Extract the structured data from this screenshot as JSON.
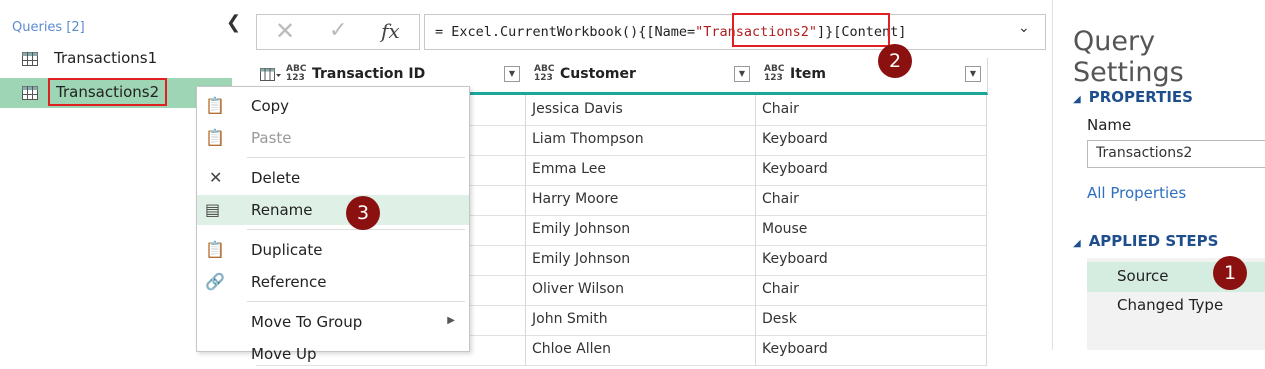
{
  "queries": {
    "header": "Queries [2]",
    "items": [
      {
        "label": "Transactions1"
      },
      {
        "label": "Transactions2"
      }
    ]
  },
  "formula_bar": {
    "prefix": "= Excel.CurrentWorkbook(){[Name=",
    "name_string": "\"Transactions2\"",
    "suffix": "]}[Content]",
    "fx_label": "fx"
  },
  "grid": {
    "columns": [
      {
        "type": "ABC\n123",
        "label": "Transaction ID"
      },
      {
        "type": "ABC\n123",
        "label": "Customer"
      },
      {
        "type": "ABC\n123",
        "label": "Item"
      }
    ],
    "rows": [
      {
        "customer": "Jessica Davis",
        "item": "Chair"
      },
      {
        "customer": "Liam Thompson",
        "item": "Keyboard"
      },
      {
        "customer": "Emma Lee",
        "item": "Keyboard"
      },
      {
        "customer": "Harry Moore",
        "item": "Chair"
      },
      {
        "customer": "Emily Johnson",
        "item": "Mouse"
      },
      {
        "customer": "Emily Johnson",
        "item": "Keyboard"
      },
      {
        "customer": "Oliver Wilson",
        "item": "Chair"
      },
      {
        "customer": "John Smith",
        "item": "Desk"
      },
      {
        "customer": "Chloe Allen",
        "item": "Keyboard"
      }
    ]
  },
  "context_menu": {
    "copy": "Copy",
    "paste": "Paste",
    "delete": "Delete",
    "rename": "Rename",
    "duplicate": "Duplicate",
    "reference": "Reference",
    "move_to_group": "Move To Group",
    "move_up": "Move Up"
  },
  "callouts": {
    "one": "1",
    "two": "2",
    "three": "3"
  },
  "settings": {
    "title": "Query Settings",
    "properties_header": "PROPERTIES",
    "name_label": "Name",
    "name_value": "Transactions2",
    "all_properties": "All Properties",
    "applied_steps_header": "APPLIED STEPS",
    "steps": [
      "Source",
      "Changed Type"
    ]
  },
  "colors": {
    "accent": "#1aa79a",
    "selected_query": "#9ed5b5",
    "callout": "#8b1111",
    "highlight_border": "#e02020"
  }
}
